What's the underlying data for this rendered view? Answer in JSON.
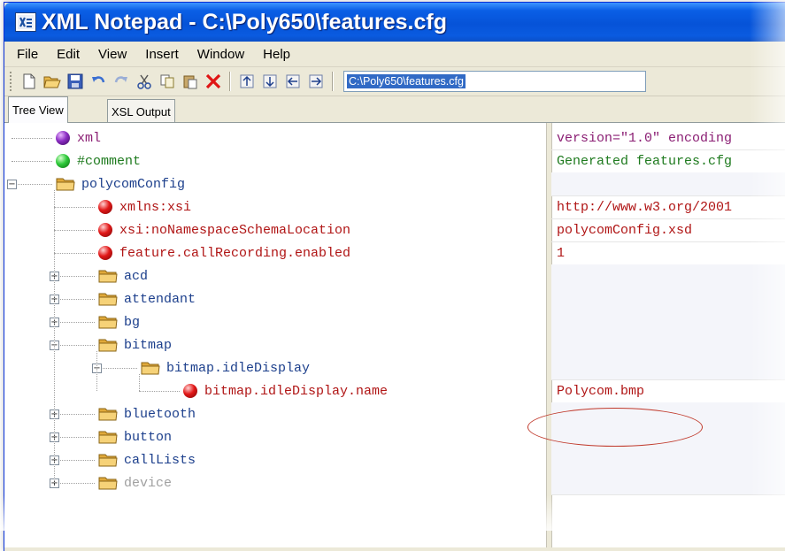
{
  "window": {
    "title": "XML Notepad - C:\\Poly650\\features.cfg",
    "icon": "xml-notepad-icon"
  },
  "menu": [
    "File",
    "Edit",
    "View",
    "Insert",
    "Window",
    "Help"
  ],
  "toolbar": {
    "buttons": [
      "new-icon",
      "open-icon",
      "save-icon",
      "undo-icon",
      "redo-icon",
      "cut-icon",
      "copy-icon",
      "paste-icon",
      "delete-icon",
      "nudge-up-icon",
      "nudge-down-icon",
      "nudge-left-icon",
      "nudge-right-icon"
    ],
    "path_value": "C:\\Poly650\\features.cfg"
  },
  "tabs": [
    "Tree View",
    "XSL Output"
  ],
  "tree": [
    {
      "label": "xml",
      "icon": "purple-ball",
      "color": "#8b1f74",
      "value": "version=\"1.0\" encoding",
      "expander": ""
    },
    {
      "label": "#comment",
      "icon": "green-ball",
      "color": "#1e7a1e",
      "value": "Generated features.cfg",
      "expander": ""
    },
    {
      "label": "polycomConfig",
      "icon": "folder",
      "color": "#1c3f8c",
      "value": "",
      "expander": "−"
    },
    {
      "label": "xmlns:xsi",
      "icon": "red-ball",
      "color": "#b01515",
      "value": "http://www.w3.org/2001",
      "expander": ""
    },
    {
      "label": "xsi:noNamespaceSchemaLocation",
      "icon": "red-ball",
      "color": "#b01515",
      "value": "polycomConfig.xsd",
      "expander": ""
    },
    {
      "label": "feature.callRecording.enabled",
      "icon": "red-ball",
      "color": "#b01515",
      "value": "1",
      "expander": ""
    },
    {
      "label": "acd",
      "icon": "folder",
      "color": "#1c3f8c",
      "value": "",
      "expander": "+"
    },
    {
      "label": "attendant",
      "icon": "folder",
      "color": "#1c3f8c",
      "value": "",
      "expander": "+"
    },
    {
      "label": "bg",
      "icon": "folder",
      "color": "#1c3f8c",
      "value": "",
      "expander": "+"
    },
    {
      "label": "bitmap",
      "icon": "folder",
      "color": "#1c3f8c",
      "value": "",
      "expander": "−"
    },
    {
      "label": "bitmap.idleDisplay",
      "icon": "folder",
      "color": "#1c3f8c",
      "value": "",
      "expander": "−"
    },
    {
      "label": "bitmap.idleDisplay.name",
      "icon": "red-ball",
      "color": "#b01515",
      "value": "Polycom.bmp",
      "expander": ""
    },
    {
      "label": "bluetooth",
      "icon": "folder",
      "color": "#1c3f8c",
      "value": "",
      "expander": "+"
    },
    {
      "label": "button",
      "icon": "folder",
      "color": "#1c3f8c",
      "value": "",
      "expander": "+"
    },
    {
      "label": "callLists",
      "icon": "folder",
      "color": "#1c3f8c",
      "value": "",
      "expander": "+"
    },
    {
      "label": "device",
      "icon": "folder",
      "color": "#a0a0a0",
      "value": "",
      "expander": "+"
    }
  ]
}
